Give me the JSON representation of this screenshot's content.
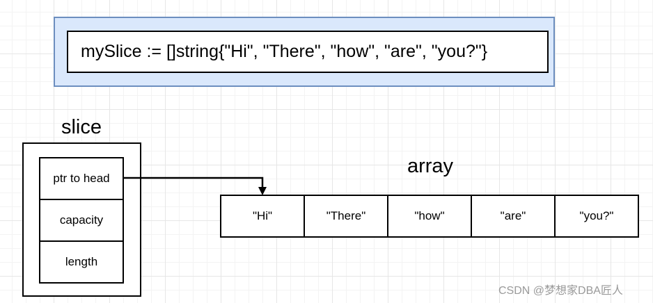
{
  "code": {
    "text": "mySlice := []string{\"Hi\", \"There\", \"how\", \"are\", \"you?\"}",
    "fill_color": "#dae8fc",
    "border_color": "#6c8ebf"
  },
  "slice": {
    "title": "slice",
    "fields": [
      "ptr to head",
      "capacity",
      "length"
    ]
  },
  "array": {
    "title": "array",
    "cells": [
      "\"Hi\"",
      "\"There\"",
      "\"how\"",
      "\"are\"",
      "\"you?\""
    ]
  },
  "connector": {
    "from": "ptr to head",
    "to": "\"Hi\"",
    "color": "#000000",
    "arrowhead": "filled-triangle"
  },
  "watermark": "CSDN @梦想家DBA匠人"
}
